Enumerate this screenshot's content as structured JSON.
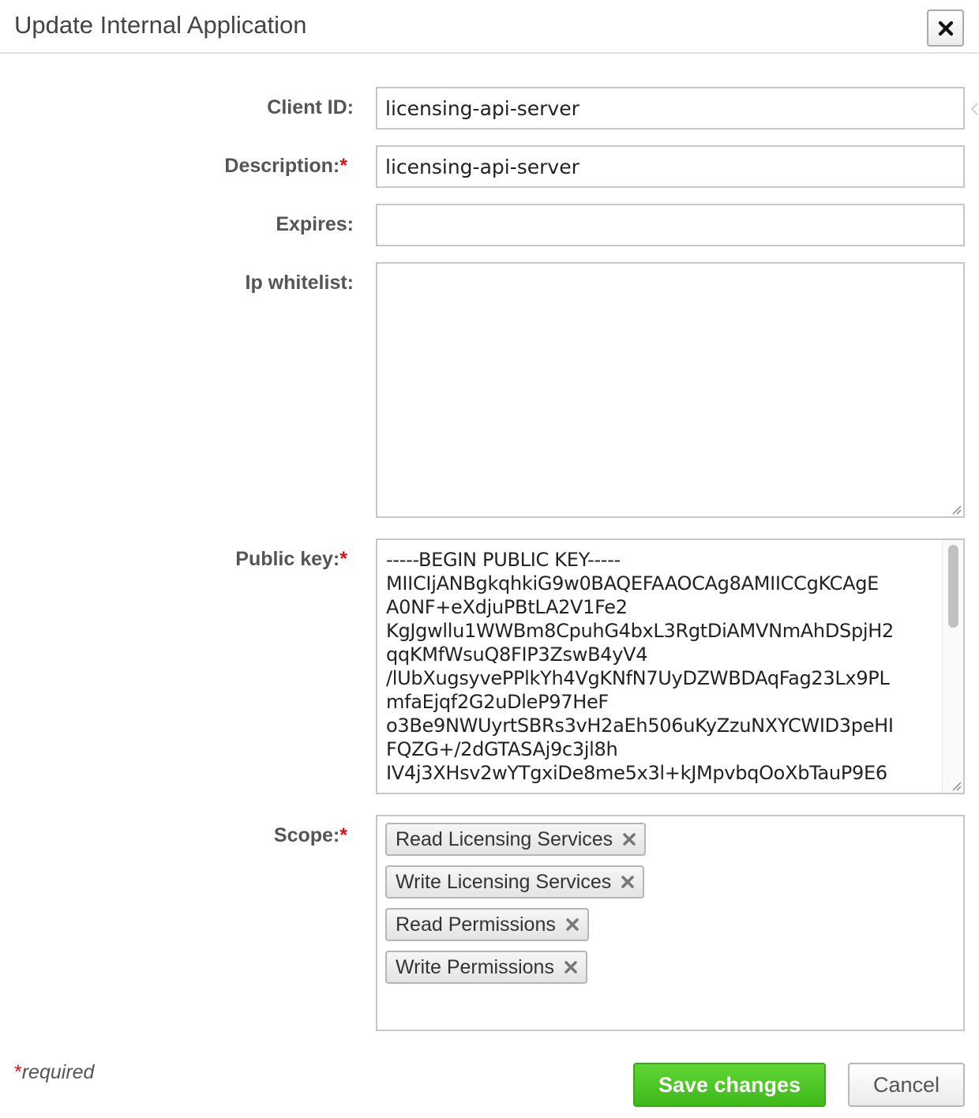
{
  "dialog": {
    "title": "Update Internal Application"
  },
  "form": {
    "client_id": {
      "label": "Client ID:",
      "value": "licensing-api-server"
    },
    "description": {
      "label": "Description:",
      "required_mark": "*",
      "value": "licensing-api-server"
    },
    "expires": {
      "label": "Expires:",
      "value": ""
    },
    "ip_whitelist": {
      "label": "Ip whitelist:",
      "value": ""
    },
    "public_key": {
      "label": "Public key:",
      "required_mark": "*",
      "value": "-----BEGIN PUBLIC KEY-----\nMIICIjANBgkqhkiG9w0BAQEFAAOCAg8AMIICCgKCAgE\nA0NF+eXdjuPBtLA2V1Fe2\nKgJgwllu1WWBm8CpuhG4bxL3RgtDiAMVNmAhDSpjH2\nqqKMfWsuQ8FIP3ZswB4yV4\n/lUbXugsyvePPlkYh4VgKNfN7UyDZWBDAqFag23Lx9PL\nmfaEjqf2G2uDleP97HeF\no3Be9NWUyrtSBRs3vH2aEh506uKyZzuNXYCWID3peHI\nFQZG+/2dGTASAj9c3jl8h\nIV4j3XHsv2wYTgxiDe8me5x3l+kJMpvbqOoXbTauP9E6"
    },
    "scope": {
      "label": "Scope:",
      "required_mark": "*",
      "tags": [
        {
          "label": "Read Licensing Services"
        },
        {
          "label": "Write Licensing Services"
        },
        {
          "label": "Read Permissions"
        },
        {
          "label": "Write Permissions"
        }
      ]
    }
  },
  "footer": {
    "required_mark": "*",
    "required_note": "required",
    "save_label": "Save changes",
    "cancel_label": "Cancel"
  },
  "icons": {
    "close": "close-icon",
    "tag_remove": "remove-tag-icon",
    "resize": "resize-grip-icon"
  },
  "colors": {
    "required": "#d9101a",
    "save_button": "#4cc625",
    "border": "#c7c7c7"
  }
}
